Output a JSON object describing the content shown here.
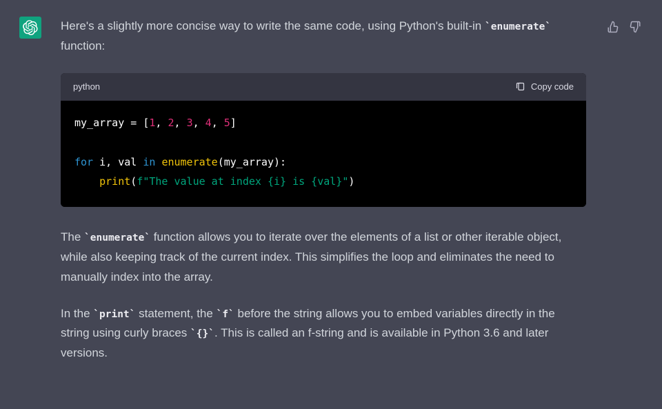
{
  "avatar": {
    "kind": "assistant-logo"
  },
  "actions": {
    "thumbs_up_icon": "thumbs-up",
    "thumbs_down_icon": "thumbs-down"
  },
  "intro": {
    "pre": "Here's a slightly more concise way to write the same code, using Python's built-in ",
    "code": "enumerate",
    "post": " function:"
  },
  "codeblock": {
    "language": "python",
    "copy_label": "Copy code",
    "line1_a": "my_array = [",
    "n1": "1",
    "n2": "2",
    "n3": "3",
    "n4": "4",
    "n5": "5",
    "sep": ", ",
    "line1_z": "]",
    "blank": "",
    "kw_for": "for",
    "mid_ival": " i, val ",
    "kw_in": "in",
    "sp": " ",
    "fn_enum": "enumerate",
    "enum_args": "(my_array):",
    "indent": "    ",
    "fn_print": "print",
    "print_open": "(",
    "fstr_f": "f\"The value at index {i} is {val}\"",
    "print_close": ")"
  },
  "para1": {
    "pre": "The ",
    "code": "enumerate",
    "post": " function allows you to iterate over the elements of a list or other iterable object, while also keeping track of the current index. This simplifies the loop and eliminates the need to manually index into the array."
  },
  "para2": {
    "p1": "In the ",
    "c1": "print",
    "p2": " statement, the ",
    "c2": "f",
    "p3": " before the string allows you to embed variables directly in the string using curly braces ",
    "c3": "{}",
    "p4": ". This is called an f-string and is available in Python 3.6 and later versions."
  }
}
